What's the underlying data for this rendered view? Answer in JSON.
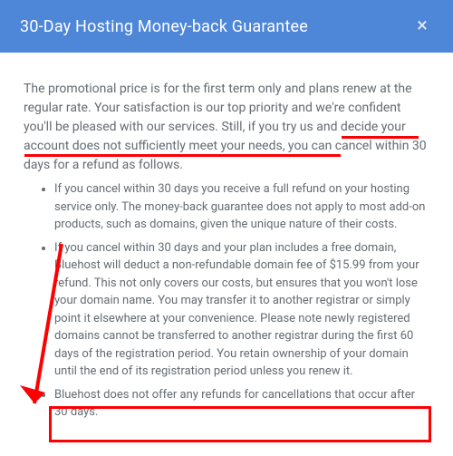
{
  "header": {
    "title": "30-Day Hosting Money-back Guarantee",
    "close_glyph": "×"
  },
  "body": {
    "intro": "The promotional price is for the first term only and plans renew at the regular rate. Your satisfaction is our top priority and we're confident you'll be pleased with our services. Still, if you try us and decide your account does not sufficiently meet your needs, you can cancel within 30 days for a refund as follows.",
    "bullets": [
      "If you cancel within 30 days you receive a full refund on your hosting service only. The money-back guarantee does not apply to most add-on products, such as domains, given the unique nature of their costs.",
      "If you cancel within 30 days and your plan includes a free domain, Bluehost will deduct a non-refundable domain fee of $15.99 from your refund. This not only covers our costs, but ensures that you won't lose your domain name. You may transfer it to another registrar or simply point it elsewhere at your convenience. Please note newly registered domains cannot be transferred to another registrar during the first 60 days of the registration period. You retain ownership of your domain until the end of its registration period unless you renew it.",
      "Bluehost does not offer any refunds for cancellations that occur after 30 days."
    ]
  }
}
